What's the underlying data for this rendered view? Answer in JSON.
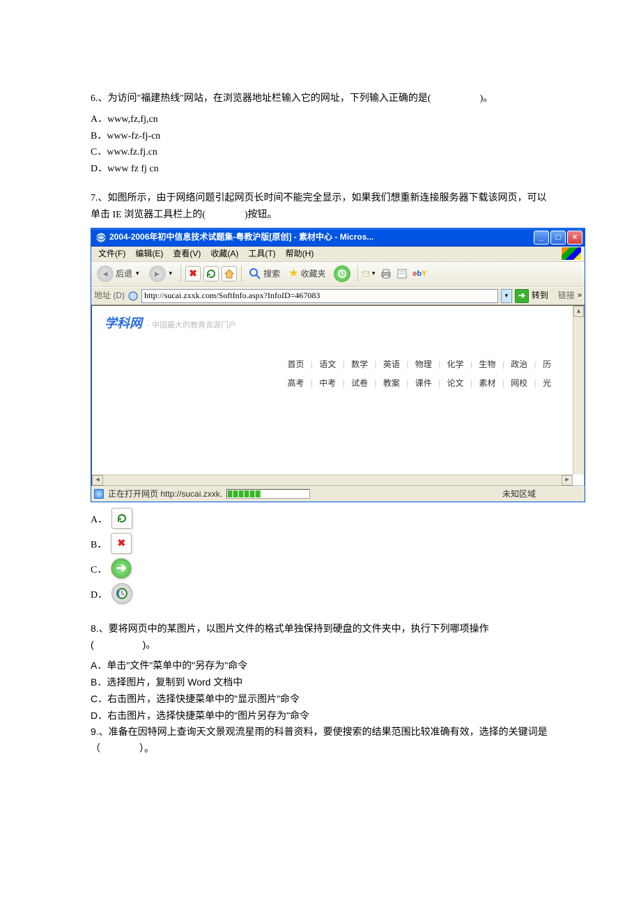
{
  "q6": {
    "stem": "6.、为访问\"福建热线\"网站，在浏览器地址栏输入它的网址，下列输入正确的是(　　　　　)。",
    "A": "A．www,fz,fj,cn",
    "B": "B．www-fz-fj-cn",
    "C": "C．www.fz.fj.cn",
    "D": "D．www fz fj cn"
  },
  "q7": {
    "stem": "7.、如图所示，由于网络问题引起网页长时间不能完全显示，如果我们想重新连接服务器下载该网页，可以单击 IE 浏览器工具栏上的(　　　　)按钮。",
    "ans_A": "A．",
    "ans_B": "B．",
    "ans_C": "C．",
    "ans_D": "D．"
  },
  "ie": {
    "title": "2004-2006年初中信息技术试题集-粤教沪版[原创] - 素材中心 - Micros...",
    "menu": {
      "file": "文件(F)",
      "edit": "编辑(E)",
      "view": "查看(V)",
      "fav": "收藏(A)",
      "tools": "工具(T)",
      "help": "帮助(H)"
    },
    "toolbar": {
      "back": "后退",
      "search": "搜索",
      "favorites": "收藏夹",
      "ebay": "ebY"
    },
    "addr": {
      "label": "地址 (D)",
      "url": "http://sucai.zxxk.com/SoftInfo.aspx?InfoID=467083",
      "go": "转到",
      "links": "链接"
    },
    "page": {
      "logo": "学科网",
      "slogan": "- 中国最大的教育资源门户",
      "row1": [
        "首页",
        "语文",
        "数学",
        "英语",
        "物理",
        "化学",
        "生物",
        "政治",
        "历"
      ],
      "row2": [
        "高考",
        "中考",
        "试卷",
        "教案",
        "课件",
        "论文",
        "素材",
        "网校",
        "光"
      ]
    },
    "status": {
      "loading": "正在打开网页 http://sucai.zxxk.",
      "zone": "未知区域"
    }
  },
  "q8": {
    "stem": "8.、要将网页中的某图片，以图片文件的格式单独保持到硬盘的文件夹中，执行下列哪项操作(　　　　　)。",
    "A": "A．单击\"文件\"菜单中的\"另存为\"命令",
    "B": "B．选择图片，复制到 Word 文档中",
    "C": "C．右击图片，选择快捷菜单中的\"显示图片\"命令",
    "D": "D．右击图片，选择快捷菜单中的\"图片另存为\"命令"
  },
  "q9": {
    "stem": "9.、准备在因特网上查询天文景观流星雨的科普资料，要使搜索的结果范围比较准确有效，选择的关键词是（　　　　）。"
  }
}
